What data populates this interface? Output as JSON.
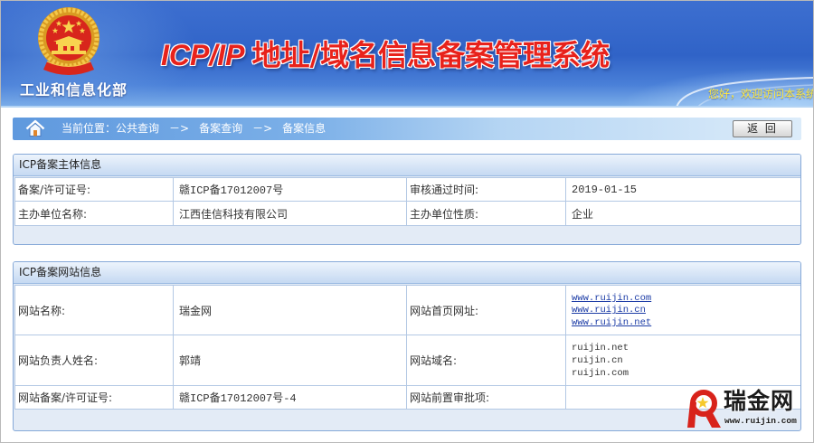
{
  "header": {
    "org_name": "工业和信息化部",
    "title_prefix": "ICP/IP",
    "title_main": "地址/域名信息备案管理系统",
    "welcome": "您好，欢迎访问本系统"
  },
  "breadcrumb": {
    "prefix": "当前位置：",
    "items": [
      "公共查询",
      "备案查询",
      "备案信息"
    ],
    "separator": "－>"
  },
  "toolbar": {
    "back_label": "返 回"
  },
  "subject_section": {
    "title": "ICP备案主体信息",
    "license_label": "备案/许可证号:",
    "license_value": "赣ICP备17012007号",
    "approval_time_label": "审核通过时间:",
    "approval_time_value": "2019-01-15",
    "org_name_label": "主办单位名称:",
    "org_name_value": "江西佳信科技有限公司",
    "org_type_label": "主办单位性质:",
    "org_type_value": "企业"
  },
  "website_section": {
    "title": "ICP备案网站信息",
    "site_name_label": "网站名称:",
    "site_name_value": "瑞金网",
    "homepage_label": "网站首页网址:",
    "homepage_urls": [
      "www.ruijin.com",
      "www.ruijin.cn",
      "www.ruijin.net"
    ],
    "owner_label": "网站负责人姓名:",
    "owner_value": "郭靖",
    "domain_label": "网站域名:",
    "domains": [
      "ruijin.net",
      "ruijin.cn",
      "ruijin.com"
    ],
    "site_license_label": "网站备案/许可证号:",
    "site_license_value": "赣ICP备17012007号-4",
    "pre_approval_label": "网站前置审批项:"
  },
  "watermark": {
    "name": "瑞金网",
    "url": "www.ruijin.com"
  },
  "icons": {
    "emblem": "national-emblem-icon",
    "home": "home-icon",
    "watermark_logo": "ruijin-logo-icon"
  },
  "colors": {
    "title_red": "#e8221b",
    "welcome_yellow": "#ffe93d",
    "link_blue": "#1c3ca6",
    "box_border": "#86a9d8",
    "cell_border": "#b3c8e4"
  }
}
